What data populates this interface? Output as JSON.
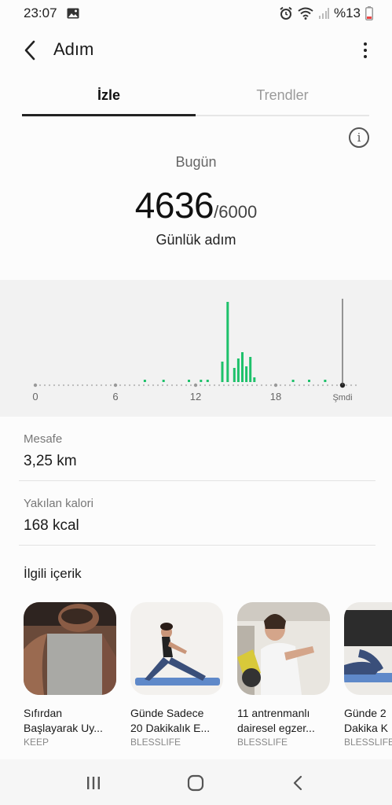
{
  "status_bar": {
    "time": "23:07",
    "battery": "%13"
  },
  "app_bar": {
    "title": "Adım"
  },
  "tabs": [
    {
      "label": "İzle",
      "active": true
    },
    {
      "label": "Trendler",
      "active": false
    }
  ],
  "summary": {
    "period": "Bugün",
    "steps": "4636",
    "goal": "/6000",
    "caption": "Günlük adım"
  },
  "chart_data": {
    "type": "bar",
    "title": "",
    "x_tick_labels": [
      "0",
      "6",
      "12",
      "18",
      "Şmdi"
    ],
    "x_ticks": [
      0,
      6,
      12,
      18,
      23
    ],
    "xlim": [
      0,
      24
    ],
    "bars": [
      {
        "x": 8.2,
        "value": 3
      },
      {
        "x": 9.6,
        "value": 3
      },
      {
        "x": 11.5,
        "value": 3
      },
      {
        "x": 12.4,
        "value": 3
      },
      {
        "x": 12.9,
        "value": 3
      },
      {
        "x": 14.0,
        "value": 26
      },
      {
        "x": 14.4,
        "value": 102
      },
      {
        "x": 14.9,
        "value": 18
      },
      {
        "x": 15.2,
        "value": 30
      },
      {
        "x": 15.5,
        "value": 38
      },
      {
        "x": 15.8,
        "value": 20
      },
      {
        "x": 16.1,
        "value": 32
      },
      {
        "x": 16.4,
        "value": 6
      },
      {
        "x": 19.3,
        "value": 3
      },
      {
        "x": 20.5,
        "value": 3
      },
      {
        "x": 21.7,
        "value": 3
      }
    ],
    "now_marker_x": 23,
    "bar_color": "#1ec16b"
  },
  "stats": [
    {
      "label": "Mesafe",
      "value": "3,25 km"
    },
    {
      "label": "Yakılan kalori",
      "value": "168 kcal"
    }
  ],
  "related": {
    "title": "İlgili içerik",
    "cards": [
      {
        "title_1": "Sıfırdan",
        "title_2": "Başlayarak Uy...",
        "source": "KEEP"
      },
      {
        "title_1": "Günde Sadece",
        "title_2": "20 Dakikalık E...",
        "source": "BLESSLIFE"
      },
      {
        "title_1": "11 antrenmanlı",
        "title_2": "dairesel egzer...",
        "source": "BLESSLIFE"
      },
      {
        "title_1": "Günde 2",
        "title_2": "Dakika K",
        "source": "BLESSLIFE"
      }
    ]
  },
  "icons": {
    "back": "back-arrow-icon",
    "more": "more-vertical-icon",
    "info": "info-icon",
    "nav_recents": "recents-icon",
    "nav_home": "home-icon",
    "nav_back": "nav-back-icon"
  }
}
